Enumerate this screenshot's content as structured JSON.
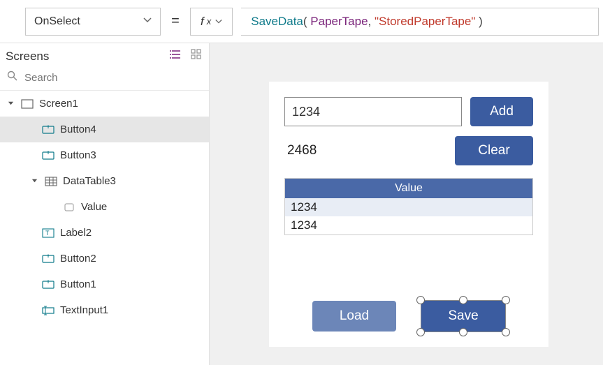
{
  "formula_bar": {
    "property": "OnSelect",
    "fn": "SaveData",
    "open": "( ",
    "arg1": "PaperTape",
    "comma": ", ",
    "arg2": "\"StoredPaperTape\"",
    "close": " )"
  },
  "tree": {
    "title": "Screens",
    "search_placeholder": "Search",
    "items": [
      {
        "label": "Screen1",
        "indent": 0,
        "type": "screen",
        "expanded": true,
        "selected": false
      },
      {
        "label": "Button4",
        "indent": 1,
        "type": "button",
        "selected": true
      },
      {
        "label": "Button3",
        "indent": 1,
        "type": "button",
        "selected": false
      },
      {
        "label": "DataTable3",
        "indent": 1,
        "type": "table",
        "expanded": true,
        "selected": false
      },
      {
        "label": "Value",
        "indent": 2,
        "type": "column",
        "selected": false
      },
      {
        "label": "Label2",
        "indent": 1,
        "type": "label",
        "selected": false
      },
      {
        "label": "Button2",
        "indent": 1,
        "type": "button",
        "selected": false
      },
      {
        "label": "Button1",
        "indent": 1,
        "type": "button",
        "selected": false
      },
      {
        "label": "TextInput1",
        "indent": 1,
        "type": "textinput",
        "selected": false
      }
    ]
  },
  "app": {
    "input_value": "1234",
    "add_label": "Add",
    "result_value": "2468",
    "clear_label": "Clear",
    "table_header": "Value",
    "rows": [
      "1234",
      "1234"
    ],
    "load_label": "Load",
    "save_label": "Save"
  }
}
